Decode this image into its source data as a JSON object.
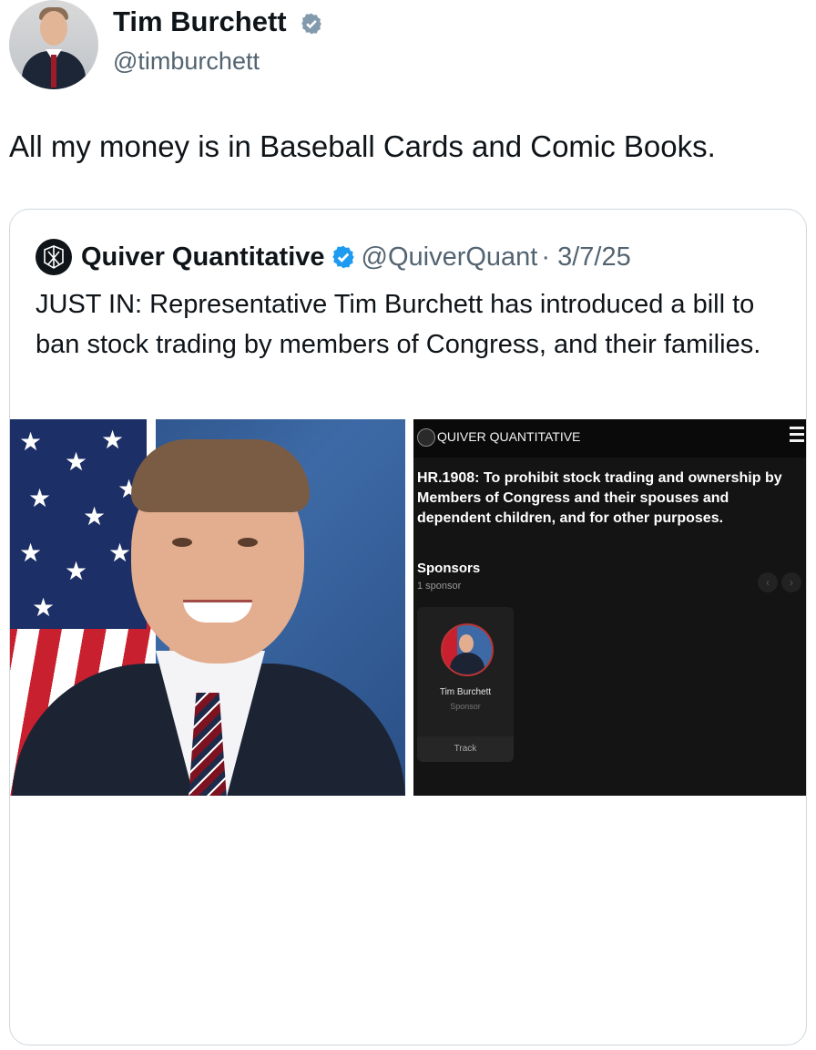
{
  "tweet": {
    "author_name": "Tim Burchett",
    "author_handle": "@timburchett",
    "text": "All my money is in Baseball Cards and Comic Books."
  },
  "quote": {
    "author_name": "Quiver Quantitative",
    "author_handle": "@QuiverQuant",
    "date": "· 3/7/25",
    "text": "JUST IN: Representative Tim Burchett has introduced a bill to ban stock trading by members of Congress, and their families."
  },
  "bill_screenshot": {
    "brand": "QUIVER QUANTITATIVE",
    "title": "HR.1908: To prohibit stock trading and ownership by Members of Congress and their spouses and dependent children, and for other purposes.",
    "sponsors_label": "Sponsors",
    "sponsors_count": "1 sponsor",
    "nav_prev": "‹",
    "nav_next": "›",
    "card": {
      "name": "Tim Burchett",
      "role": "Sponsor",
      "action": "Track"
    }
  },
  "colors": {
    "verified_blue": "#1d9bf0",
    "verified_gray": "#829aab",
    "handle_gray": "#536471",
    "border": "#cfd9de"
  },
  "icons": [
    "verified-gray-icon",
    "verified-blue-icon",
    "quiver-logo-icon",
    "hamburger-menu-icon"
  ]
}
